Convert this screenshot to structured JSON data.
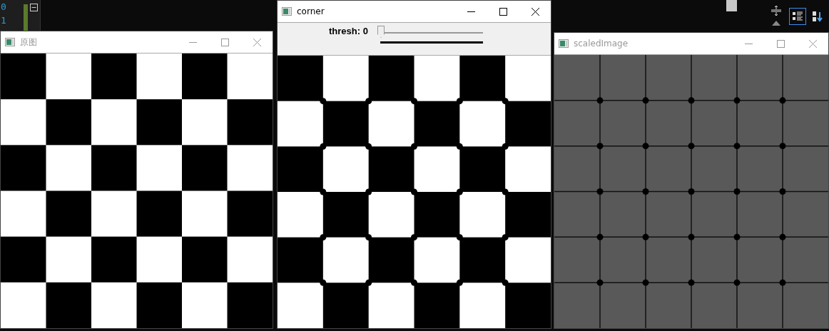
{
  "editor": {
    "line_numbers": [
      "0",
      "1"
    ]
  },
  "ide_toolbar": [
    {
      "kind": "categorized",
      "selected": true
    },
    {
      "kind": "alphabetical",
      "selected": false
    }
  ],
  "windows": [
    {
      "title": "原图",
      "active": false,
      "kind": "checkerboard"
    },
    {
      "title": "corner",
      "active": true,
      "kind": "corners",
      "trackbar": {
        "label": "thresh: 0",
        "level": 0
      }
    },
    {
      "title": "scaledImage",
      "active": false,
      "kind": "grid"
    }
  ]
}
